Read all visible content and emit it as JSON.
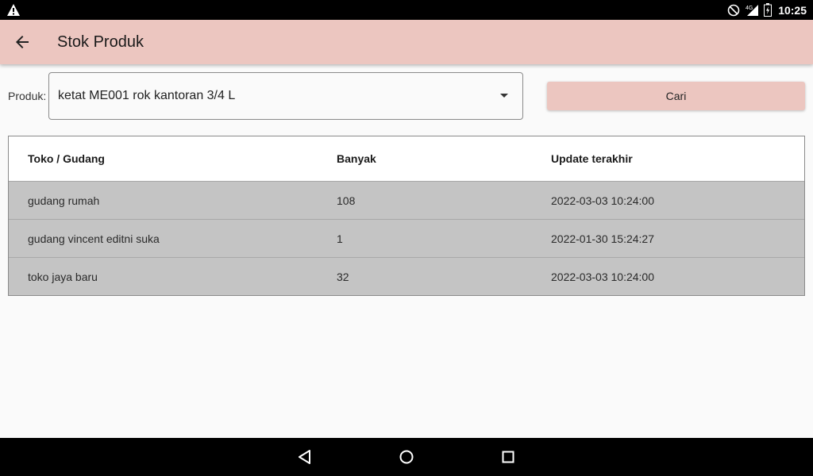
{
  "status_bar": {
    "time": "10:25",
    "network": "4G",
    "icons": [
      "warning-icon",
      "do-not-disturb-icon",
      "signal-icon",
      "battery-icon"
    ]
  },
  "app_bar": {
    "title": "Stok Produk",
    "back_icon": "arrow-left-icon"
  },
  "form": {
    "produk_label": "Produk:",
    "produk_value": "ketat ME001 rok kantoran 3/4 L",
    "cari_label": "Cari"
  },
  "table": {
    "headers": [
      "Toko / Gudang",
      "Banyak",
      "Update terakhir"
    ],
    "rows": [
      [
        "gudang rumah",
        "108",
        "2022-03-03 10:24:00"
      ],
      [
        "gudang vincent editni suka",
        "1",
        "2022-01-30 15:24:27"
      ],
      [
        "toko jaya baru",
        "32",
        "2022-03-03 10:24:00"
      ]
    ]
  },
  "colors": {
    "accent": "#ecc6c0",
    "row_bg": "#c4c4c4"
  },
  "nav_bar": {
    "icons": [
      "back-triangle-icon",
      "home-circle-icon",
      "recents-square-icon"
    ]
  }
}
